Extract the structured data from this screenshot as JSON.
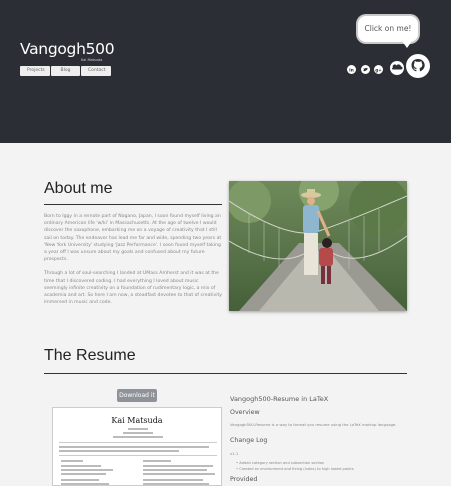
{
  "header": {
    "brand": "Vangogh500",
    "brand_sub": "Kai Matsuda",
    "nav": [
      "Projects",
      "Blog",
      "Contact"
    ],
    "bubble": "Click on me!",
    "social_icons": [
      "linkedin-icon",
      "twitter-icon",
      "google-plus-icon",
      "soundcloud-icon",
      "github-icon"
    ]
  },
  "about": {
    "title": "About me",
    "paragraphs": [
      "Born to Iggy in a remote part of Nagano, Japan, I soon found myself living an ordinary American life 'w/ki' in Massachusetts. At the age of twelve I would discover the saxophone, embarking me on a voyage of creativity that I still sail on today. The endeavor has lead me far and wide, spending two years at 'New York University' studying 'Jazz Performance'. I soon found myself taking a year off I was unsure about my goals and confused about my future prospects.",
      "Through a lot of soul-searching I landed at UMass Amherst and it was at the time that I discovered coding. I had everything I loved about music seemingly infinite creativity on a foundation of rudimentary logic, a mix of academia and art. So here I am now, a steadfast devotee to that of creativity immersed in music and code."
    ]
  },
  "resume": {
    "title": "The Resume",
    "download": "Download it",
    "sheet_name": "Kai Matsuda",
    "side_title": "Vangogh500-Resume in LaTeX",
    "overview_head": "Overview",
    "overview_text": "Vangogh500-Resume is a way to format you resume using the LaTeX markup language.",
    "changelog_head": "Change Log",
    "version": "v1.1",
    "changes": [
      "Added category section and subsection section",
      "Created an environment and fixing (index) to high lowed points"
    ],
    "provided_head": "Provided"
  }
}
